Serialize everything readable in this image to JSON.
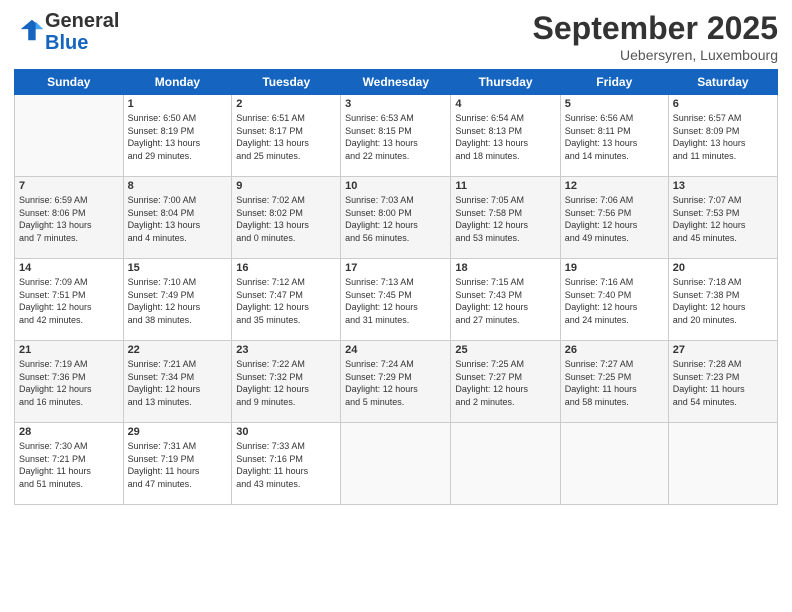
{
  "header": {
    "logo_general": "General",
    "logo_blue": "Blue",
    "month": "September 2025",
    "location": "Uebersyren, Luxembourg"
  },
  "days_of_week": [
    "Sunday",
    "Monday",
    "Tuesday",
    "Wednesday",
    "Thursday",
    "Friday",
    "Saturday"
  ],
  "weeks": [
    [
      {
        "day": "",
        "info": ""
      },
      {
        "day": "1",
        "info": "Sunrise: 6:50 AM\nSunset: 8:19 PM\nDaylight: 13 hours\nand 29 minutes."
      },
      {
        "day": "2",
        "info": "Sunrise: 6:51 AM\nSunset: 8:17 PM\nDaylight: 13 hours\nand 25 minutes."
      },
      {
        "day": "3",
        "info": "Sunrise: 6:53 AM\nSunset: 8:15 PM\nDaylight: 13 hours\nand 22 minutes."
      },
      {
        "day": "4",
        "info": "Sunrise: 6:54 AM\nSunset: 8:13 PM\nDaylight: 13 hours\nand 18 minutes."
      },
      {
        "day": "5",
        "info": "Sunrise: 6:56 AM\nSunset: 8:11 PM\nDaylight: 13 hours\nand 14 minutes."
      },
      {
        "day": "6",
        "info": "Sunrise: 6:57 AM\nSunset: 8:09 PM\nDaylight: 13 hours\nand 11 minutes."
      }
    ],
    [
      {
        "day": "7",
        "info": "Sunrise: 6:59 AM\nSunset: 8:06 PM\nDaylight: 13 hours\nand 7 minutes."
      },
      {
        "day": "8",
        "info": "Sunrise: 7:00 AM\nSunset: 8:04 PM\nDaylight: 13 hours\nand 4 minutes."
      },
      {
        "day": "9",
        "info": "Sunrise: 7:02 AM\nSunset: 8:02 PM\nDaylight: 13 hours\nand 0 minutes."
      },
      {
        "day": "10",
        "info": "Sunrise: 7:03 AM\nSunset: 8:00 PM\nDaylight: 12 hours\nand 56 minutes."
      },
      {
        "day": "11",
        "info": "Sunrise: 7:05 AM\nSunset: 7:58 PM\nDaylight: 12 hours\nand 53 minutes."
      },
      {
        "day": "12",
        "info": "Sunrise: 7:06 AM\nSunset: 7:56 PM\nDaylight: 12 hours\nand 49 minutes."
      },
      {
        "day": "13",
        "info": "Sunrise: 7:07 AM\nSunset: 7:53 PM\nDaylight: 12 hours\nand 45 minutes."
      }
    ],
    [
      {
        "day": "14",
        "info": "Sunrise: 7:09 AM\nSunset: 7:51 PM\nDaylight: 12 hours\nand 42 minutes."
      },
      {
        "day": "15",
        "info": "Sunrise: 7:10 AM\nSunset: 7:49 PM\nDaylight: 12 hours\nand 38 minutes."
      },
      {
        "day": "16",
        "info": "Sunrise: 7:12 AM\nSunset: 7:47 PM\nDaylight: 12 hours\nand 35 minutes."
      },
      {
        "day": "17",
        "info": "Sunrise: 7:13 AM\nSunset: 7:45 PM\nDaylight: 12 hours\nand 31 minutes."
      },
      {
        "day": "18",
        "info": "Sunrise: 7:15 AM\nSunset: 7:43 PM\nDaylight: 12 hours\nand 27 minutes."
      },
      {
        "day": "19",
        "info": "Sunrise: 7:16 AM\nSunset: 7:40 PM\nDaylight: 12 hours\nand 24 minutes."
      },
      {
        "day": "20",
        "info": "Sunrise: 7:18 AM\nSunset: 7:38 PM\nDaylight: 12 hours\nand 20 minutes."
      }
    ],
    [
      {
        "day": "21",
        "info": "Sunrise: 7:19 AM\nSunset: 7:36 PM\nDaylight: 12 hours\nand 16 minutes."
      },
      {
        "day": "22",
        "info": "Sunrise: 7:21 AM\nSunset: 7:34 PM\nDaylight: 12 hours\nand 13 minutes."
      },
      {
        "day": "23",
        "info": "Sunrise: 7:22 AM\nSunset: 7:32 PM\nDaylight: 12 hours\nand 9 minutes."
      },
      {
        "day": "24",
        "info": "Sunrise: 7:24 AM\nSunset: 7:29 PM\nDaylight: 12 hours\nand 5 minutes."
      },
      {
        "day": "25",
        "info": "Sunrise: 7:25 AM\nSunset: 7:27 PM\nDaylight: 12 hours\nand 2 minutes."
      },
      {
        "day": "26",
        "info": "Sunrise: 7:27 AM\nSunset: 7:25 PM\nDaylight: 11 hours\nand 58 minutes."
      },
      {
        "day": "27",
        "info": "Sunrise: 7:28 AM\nSunset: 7:23 PM\nDaylight: 11 hours\nand 54 minutes."
      }
    ],
    [
      {
        "day": "28",
        "info": "Sunrise: 7:30 AM\nSunset: 7:21 PM\nDaylight: 11 hours\nand 51 minutes."
      },
      {
        "day": "29",
        "info": "Sunrise: 7:31 AM\nSunset: 7:19 PM\nDaylight: 11 hours\nand 47 minutes."
      },
      {
        "day": "30",
        "info": "Sunrise: 7:33 AM\nSunset: 7:16 PM\nDaylight: 11 hours\nand 43 minutes."
      },
      {
        "day": "",
        "info": ""
      },
      {
        "day": "",
        "info": ""
      },
      {
        "day": "",
        "info": ""
      },
      {
        "day": "",
        "info": ""
      }
    ]
  ]
}
